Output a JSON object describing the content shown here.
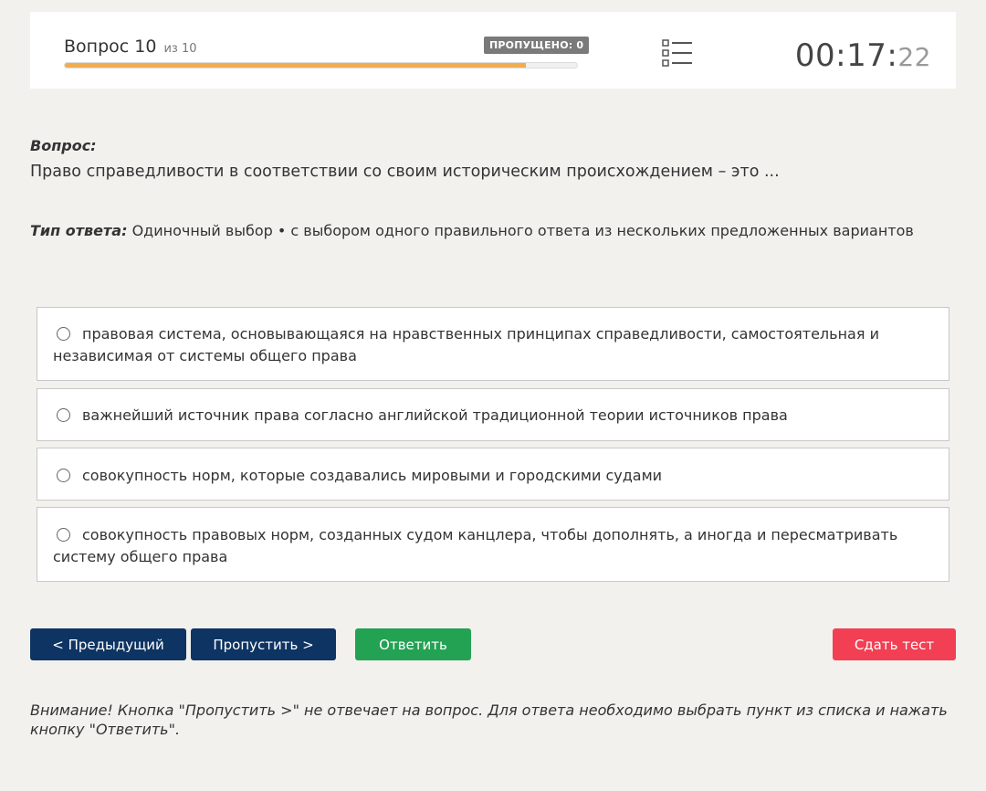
{
  "header": {
    "question_label": "Вопрос 10",
    "question_of": "из 10",
    "skipped_badge": "ПРОПУЩЕНО: 0",
    "progress": 0.9,
    "list_icon": "list-icon",
    "timer_main": "00:17:",
    "timer_seconds": "22"
  },
  "question": {
    "label": "Вопрос:",
    "text": "Право справедливости в соответствии со своим историческим происхождением – это ..."
  },
  "answer_type": {
    "label": "Тип ответа:",
    "value": "Одиночный выбор • с выбором одного правильного ответа из нескольких предложенных вариантов"
  },
  "options": [
    "правовая система, основывающаяся на нравственных принципах справедливости, самостоятельная и независимая от системы общего права",
    "важнейший источник права согласно английской традиционной теории источников права",
    "совокупность норм, которые создавались мировыми и городскими судами",
    "совокупность правовых норм, созданных судом канцлера, чтобы дополнять, а иногда и пересматривать систему общего права"
  ],
  "buttons": {
    "previous": "< Предыдущий",
    "skip": "Пропустить >",
    "answer": "Ответить",
    "submit": "Сдать тест"
  },
  "colors": {
    "progress": "#f0ad4e",
    "dark_button": "#0e3463",
    "answer_button": "#23a254",
    "submit_button": "#f23f54"
  },
  "notice": "Внимание! Кнопка \"Пропустить >\" не отвечает на вопрос. Для ответа необходимо выбрать пункт из списка и нажать кнопку \"Ответить\"."
}
